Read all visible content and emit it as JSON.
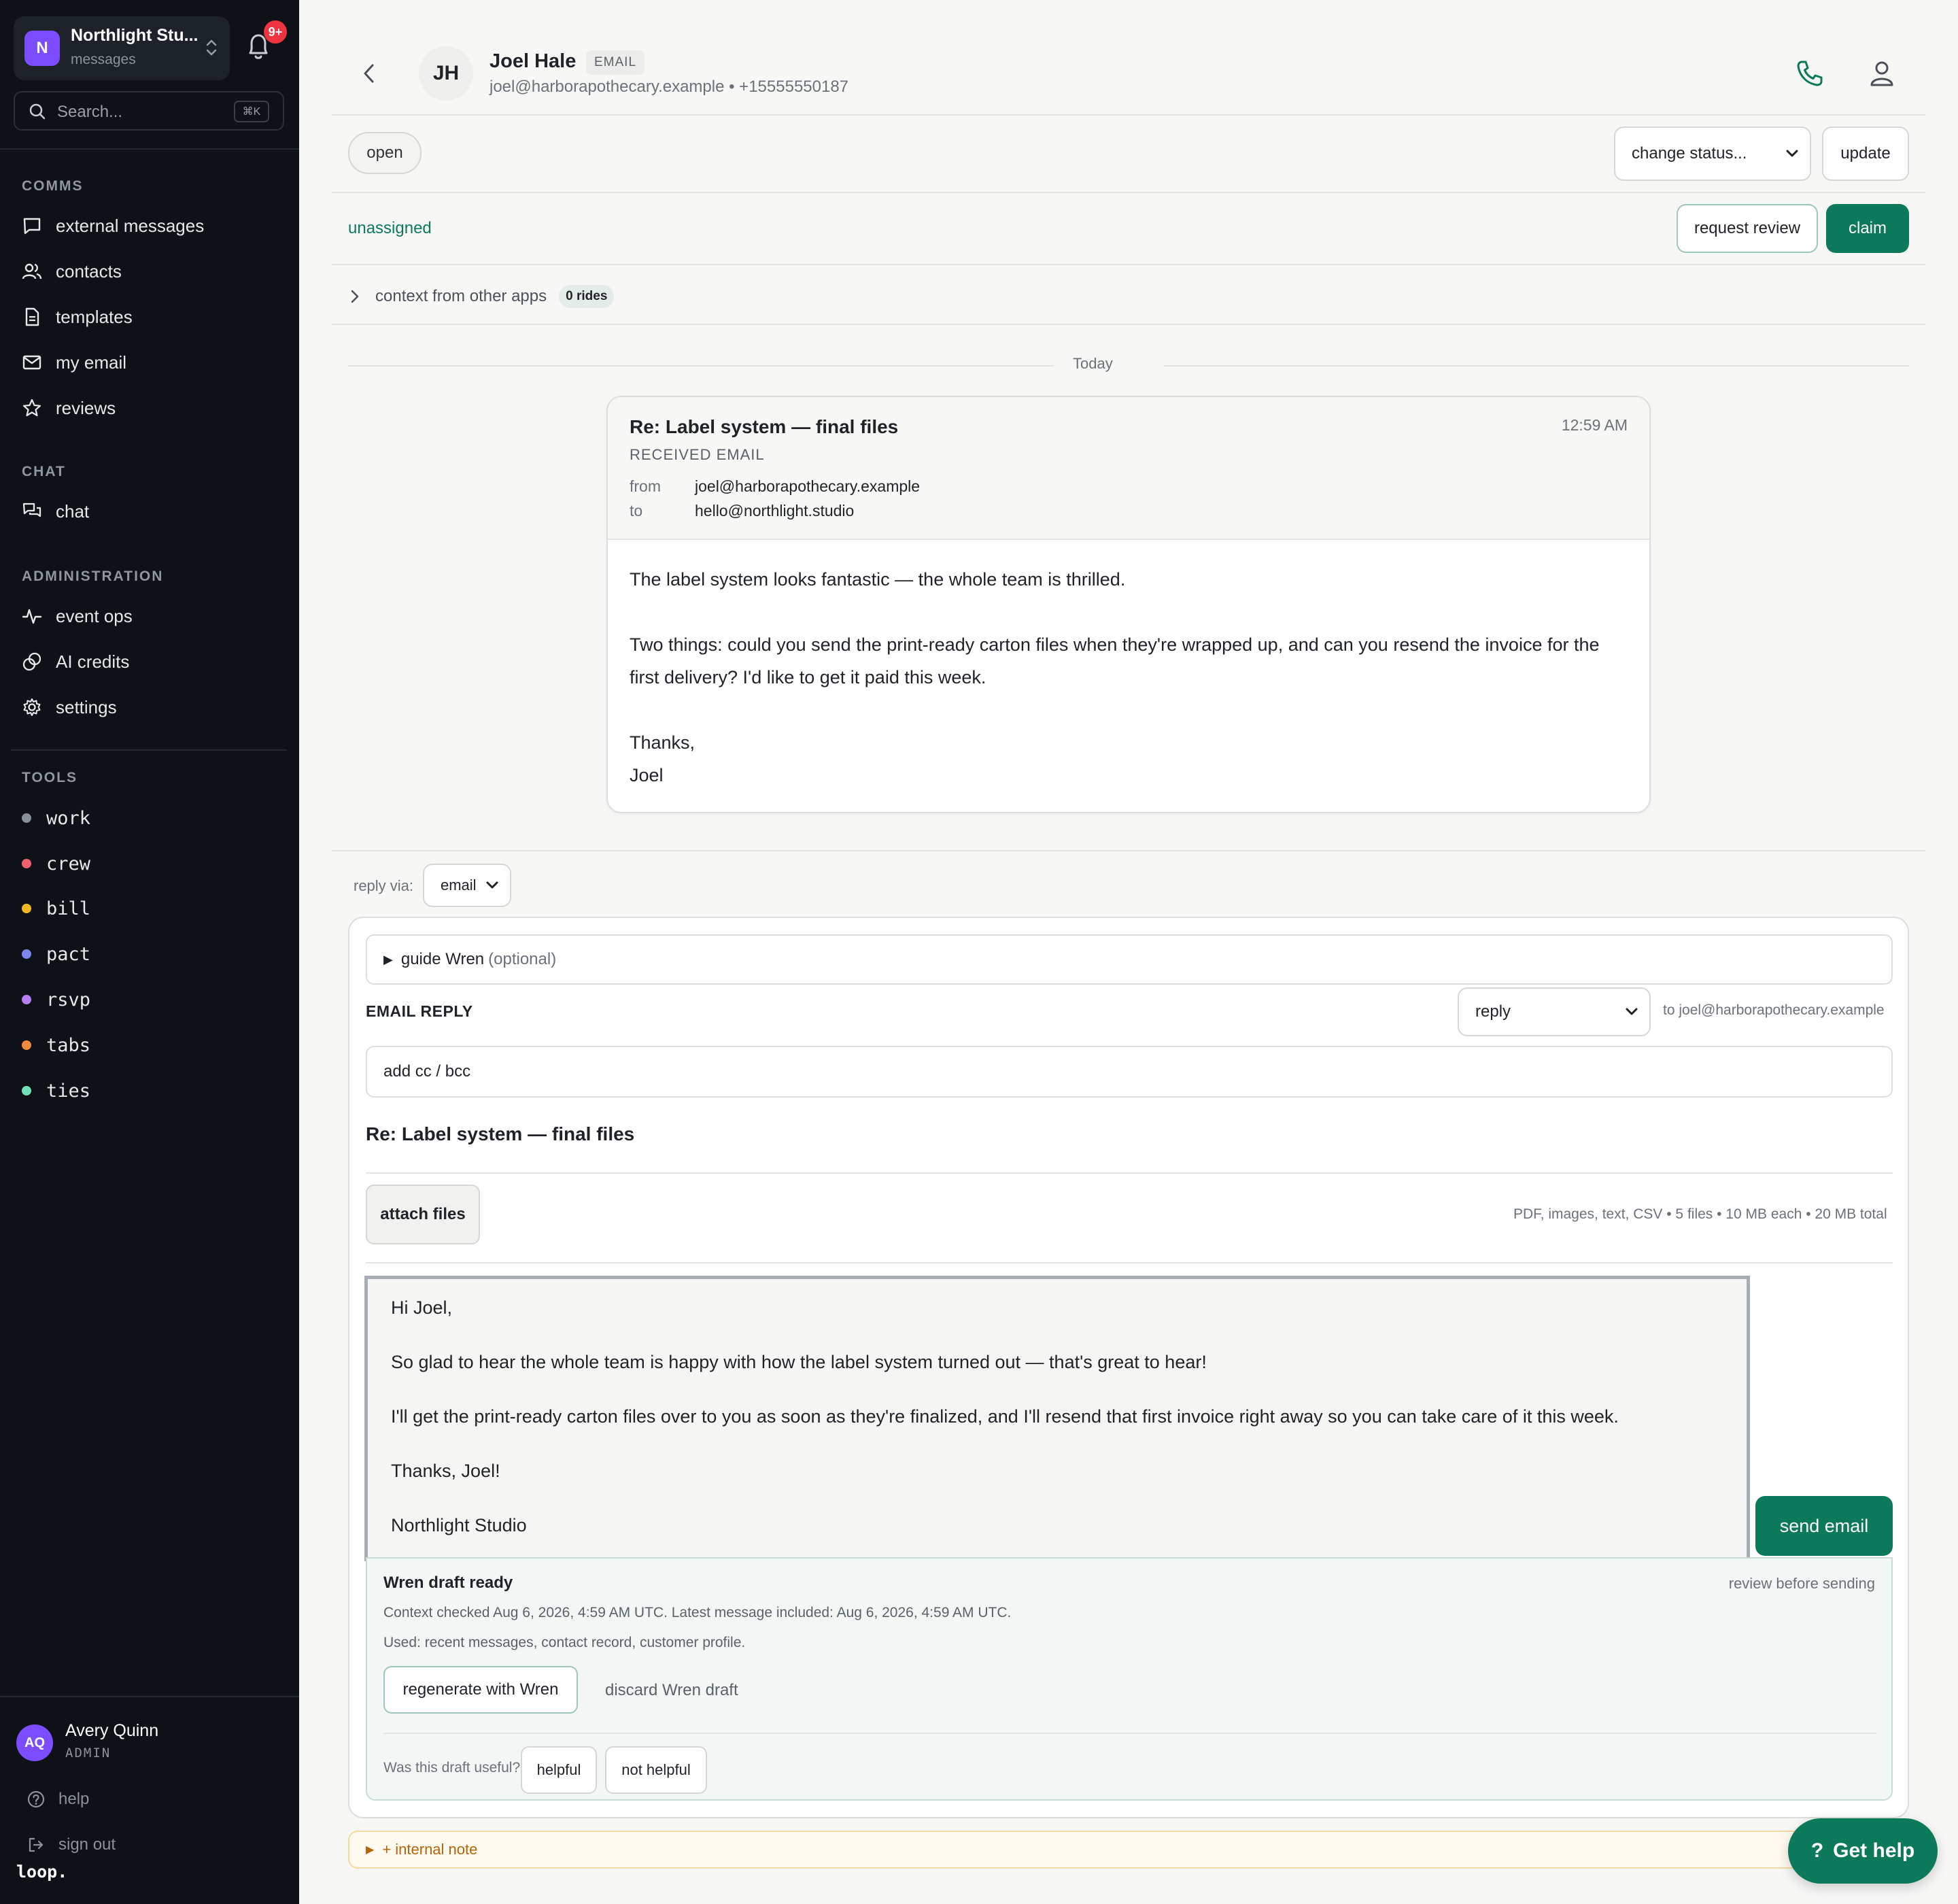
{
  "workspace": {
    "logo_letter": "N",
    "name": "Northlight Stu...",
    "sub": "messages"
  },
  "notifications": {
    "badge": "9+"
  },
  "search": {
    "placeholder": "Search...",
    "shortcut": "⌘K"
  },
  "sidebar": {
    "sections": [
      {
        "title": "COMMS",
        "items": [
          {
            "label": "external messages",
            "icon": "message-square-icon"
          },
          {
            "label": "contacts",
            "icon": "users-icon"
          },
          {
            "label": "templates",
            "icon": "file-text-icon"
          },
          {
            "label": "my email",
            "icon": "mail-icon"
          },
          {
            "label": "reviews",
            "icon": "star-icon"
          }
        ]
      },
      {
        "title": "CHAT",
        "items": [
          {
            "label": "chat",
            "icon": "chat-bubbles-icon"
          }
        ]
      },
      {
        "title": "ADMINISTRATION",
        "items": [
          {
            "label": "event ops",
            "icon": "activity-icon"
          },
          {
            "label": "AI credits",
            "icon": "coins-icon"
          },
          {
            "label": "settings",
            "icon": "gear-icon"
          }
        ]
      }
    ],
    "tools_title": "TOOLS",
    "tools": [
      {
        "label": "work",
        "color": "#8b8f99"
      },
      {
        "label": "crew",
        "color": "#f0606e"
      },
      {
        "label": "bill",
        "color": "#f5b822"
      },
      {
        "label": "pact",
        "color": "#7d86f0"
      },
      {
        "label": "rsvp",
        "color": "#b57ff5"
      },
      {
        "label": "tabs",
        "color": "#f5893a"
      },
      {
        "label": "ties",
        "color": "#74e0b9"
      }
    ],
    "user": {
      "initials": "AQ",
      "name": "Avery Quinn",
      "role": "ADMIN"
    },
    "footer": {
      "help": "help",
      "sign_out": "sign out",
      "brand": "loop."
    }
  },
  "contact": {
    "initials": "JH",
    "name": "Joel Hale",
    "channel_tag": "EMAIL",
    "subline": "joel@harborapothecary.example • +15555550187"
  },
  "status": {
    "current": "open",
    "select_value": "change status...",
    "update_label": "update"
  },
  "assignment": {
    "value": "unassigned",
    "request_review_label": "request review",
    "claim_label": "claim"
  },
  "context": {
    "label": "context from other apps",
    "badge": "0 rides"
  },
  "timeline": {
    "day_label": "Today"
  },
  "message": {
    "subject": "Re: Label system — final files",
    "kind": "RECEIVED EMAIL",
    "time": "12:59 AM",
    "from_label": "from",
    "from": "joel@harborapothecary.example",
    "to_label": "to",
    "to": "hello@northlight.studio",
    "body": [
      "The label system looks fantastic — the whole team is thrilled.",
      "Two things: could you send the print-ready carton files when they're wrapped up, and can you resend the invoice for the first delivery? I'd like to get it paid this week.",
      "Thanks,"
    ],
    "signature": "Joel"
  },
  "reply": {
    "via_label": "reply via:",
    "via_value": "email",
    "guide_label": "guide Wren",
    "guide_optional": "(optional)",
    "section_label": "EMAIL REPLY",
    "mode_value": "reply",
    "to_text": "to joel@harborapothecary.example",
    "cc_label": "add cc / bcc",
    "subject": "Re: Label system — final files",
    "attach_label": "attach files",
    "attach_info": "PDF, images, text, CSV • 5 files • 10 MB each • 20 MB total",
    "draft": [
      "Hi Joel,",
      "So glad to hear the whole team is happy with how the label system turned out — that's great to hear!",
      "I'll get the print-ready carton files over to you as soon as they're finalized, and I'll resend that first invoice right away so you can take care of it this week.",
      "Thanks, Joel!",
      "Northlight Studio"
    ],
    "send_label": "send email"
  },
  "wren": {
    "title": "Wren draft ready",
    "review_hint": "review before sending",
    "context_line": "Context checked Aug 6, 2026, 4:59 AM UTC. Latest message included: Aug 6, 2026, 4:59 AM UTC.",
    "used_line": "Used: recent messages, contact record, customer profile.",
    "regenerate_label": "regenerate with Wren",
    "discard_label": "discard Wren draft",
    "feedback_question": "Was this draft useful?",
    "helpful_label": "helpful",
    "not_helpful_label": "not helpful"
  },
  "internal_note": {
    "label": "+ internal note"
  },
  "help_fab": {
    "label": "Get help",
    "icon_glyph": "?"
  },
  "colors": {
    "accent": "#0c7a5a",
    "sidebar_bg": "#0e1116",
    "workspace_logo": "#7c4dff",
    "badge": "#ef3340"
  }
}
